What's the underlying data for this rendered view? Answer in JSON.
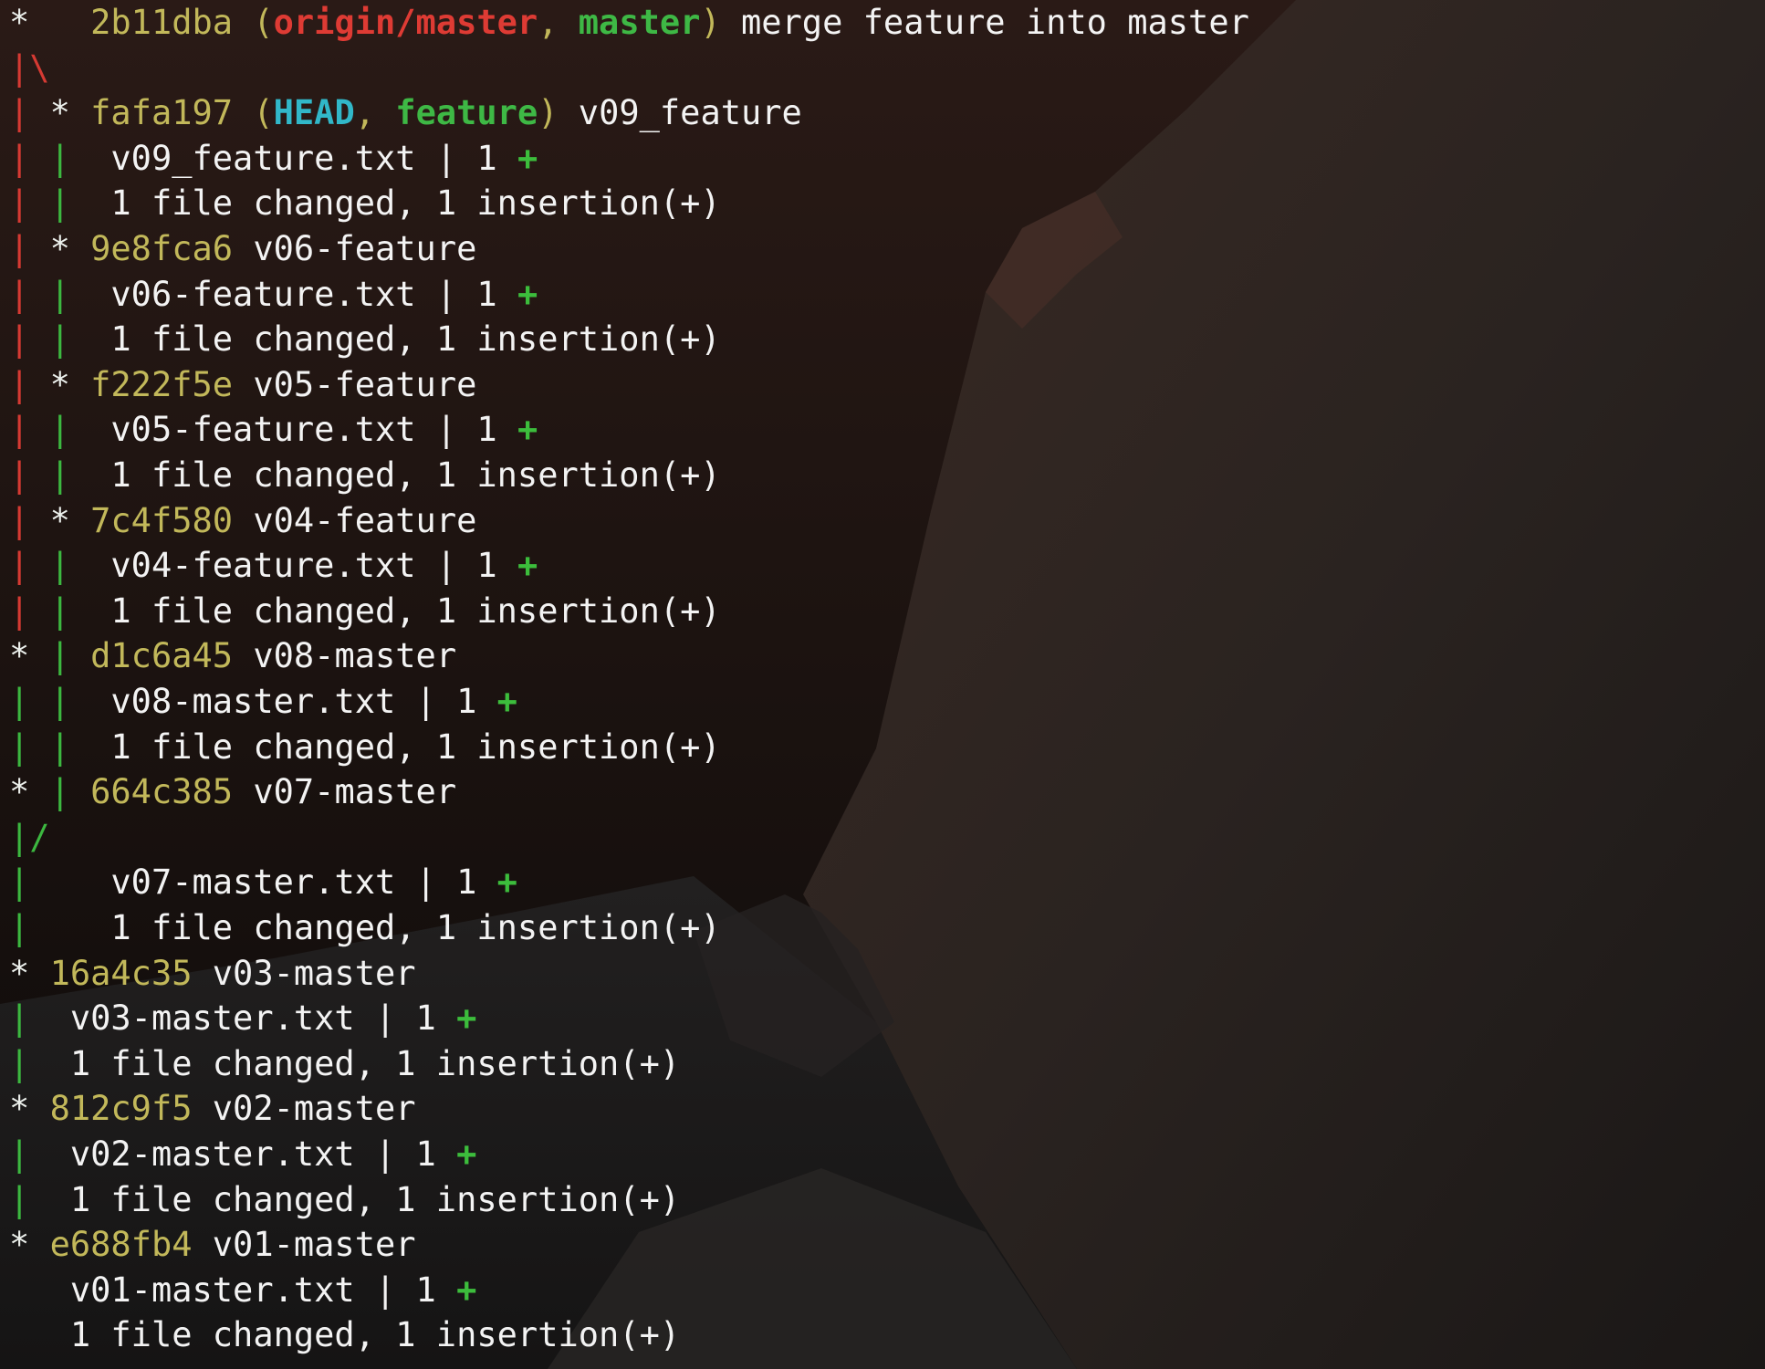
{
  "lines": [
    {
      "kind": "commit",
      "graph": [
        {
          "t": "*",
          "c": "white"
        },
        {
          "t": "   ",
          "c": "white"
        }
      ],
      "hash": "2b11dba",
      "refs": [
        {
          "t": "origin/master",
          "cls": "origin"
        },
        {
          "t": "master",
          "cls": "master-ref"
        }
      ],
      "message": "merge feature into master"
    },
    {
      "kind": "graph",
      "graph": [
        {
          "t": "|",
          "c": "red"
        },
        {
          "t": "\\",
          "c": "red"
        }
      ]
    },
    {
      "kind": "commit",
      "graph": [
        {
          "t": "| ",
          "c": "red"
        },
        {
          "t": "* ",
          "c": "white"
        }
      ],
      "hash": "fafa197",
      "refs": [
        {
          "t": "HEAD",
          "cls": "head"
        },
        {
          "t": "feature",
          "cls": "feature-ref"
        }
      ],
      "message": "v09_feature"
    },
    {
      "kind": "stat",
      "graph": [
        {
          "t": "| ",
          "c": "red"
        },
        {
          "t": "| ",
          "c": "green"
        }
      ],
      "file": "v09_feature.txt",
      "count": "1",
      "plus": "+"
    },
    {
      "kind": "summary",
      "graph": [
        {
          "t": "| ",
          "c": "red"
        },
        {
          "t": "| ",
          "c": "green"
        }
      ],
      "text": "1 file changed, 1 insertion(+)"
    },
    {
      "kind": "commit",
      "graph": [
        {
          "t": "| ",
          "c": "red"
        },
        {
          "t": "* ",
          "c": "white"
        }
      ],
      "hash": "9e8fca6",
      "refs": [],
      "message": "v06-feature"
    },
    {
      "kind": "stat",
      "graph": [
        {
          "t": "| ",
          "c": "red"
        },
        {
          "t": "| ",
          "c": "green"
        }
      ],
      "file": "v06-feature.txt",
      "count": "1",
      "plus": "+"
    },
    {
      "kind": "summary",
      "graph": [
        {
          "t": "| ",
          "c": "red"
        },
        {
          "t": "| ",
          "c": "green"
        }
      ],
      "text": "1 file changed, 1 insertion(+)"
    },
    {
      "kind": "commit",
      "graph": [
        {
          "t": "| ",
          "c": "red"
        },
        {
          "t": "* ",
          "c": "white"
        }
      ],
      "hash": "f222f5e",
      "refs": [],
      "message": "v05-feature"
    },
    {
      "kind": "stat",
      "graph": [
        {
          "t": "| ",
          "c": "red"
        },
        {
          "t": "| ",
          "c": "green"
        }
      ],
      "file": "v05-feature.txt",
      "count": "1",
      "plus": "+"
    },
    {
      "kind": "summary",
      "graph": [
        {
          "t": "| ",
          "c": "red"
        },
        {
          "t": "| ",
          "c": "green"
        }
      ],
      "text": "1 file changed, 1 insertion(+)"
    },
    {
      "kind": "commit",
      "graph": [
        {
          "t": "| ",
          "c": "red"
        },
        {
          "t": "* ",
          "c": "white"
        }
      ],
      "hash": "7c4f580",
      "refs": [],
      "message": "v04-feature"
    },
    {
      "kind": "stat",
      "graph": [
        {
          "t": "| ",
          "c": "red"
        },
        {
          "t": "| ",
          "c": "green"
        }
      ],
      "file": "v04-feature.txt",
      "count": "1",
      "plus": "+"
    },
    {
      "kind": "summary",
      "graph": [
        {
          "t": "| ",
          "c": "red"
        },
        {
          "t": "| ",
          "c": "green"
        }
      ],
      "text": "1 file changed, 1 insertion(+)"
    },
    {
      "kind": "commit",
      "graph": [
        {
          "t": "* ",
          "c": "white"
        },
        {
          "t": "| ",
          "c": "green"
        }
      ],
      "hash": "d1c6a45",
      "refs": [],
      "message": "v08-master"
    },
    {
      "kind": "stat",
      "graph": [
        {
          "t": "| ",
          "c": "green"
        },
        {
          "t": "| ",
          "c": "green"
        }
      ],
      "file": "v08-master.txt",
      "count": "1",
      "plus": "+"
    },
    {
      "kind": "summary",
      "graph": [
        {
          "t": "| ",
          "c": "green"
        },
        {
          "t": "| ",
          "c": "green"
        }
      ],
      "text": "1 file changed, 1 insertion(+)"
    },
    {
      "kind": "commit",
      "graph": [
        {
          "t": "* ",
          "c": "white"
        },
        {
          "t": "| ",
          "c": "green"
        }
      ],
      "hash": "664c385",
      "refs": [],
      "message": "v07-master"
    },
    {
      "kind": "graph",
      "graph": [
        {
          "t": "|",
          "c": "green"
        },
        {
          "t": "/",
          "c": "green"
        }
      ]
    },
    {
      "kind": "stat",
      "graph": [
        {
          "t": "| ",
          "c": "green"
        },
        {
          "t": "  ",
          "c": "green"
        }
      ],
      "file": "v07-master.txt",
      "count": "1",
      "plus": "+"
    },
    {
      "kind": "summary",
      "graph": [
        {
          "t": "| ",
          "c": "green"
        },
        {
          "t": "  ",
          "c": "green"
        }
      ],
      "text": "1 file changed, 1 insertion(+)"
    },
    {
      "kind": "commit",
      "graph": [
        {
          "t": "* ",
          "c": "white"
        }
      ],
      "hash": "16a4c35",
      "refs": [],
      "message": "v03-master"
    },
    {
      "kind": "stat",
      "graph": [
        {
          "t": "| ",
          "c": "green"
        }
      ],
      "file": "v03-master.txt",
      "count": "1",
      "plus": "+"
    },
    {
      "kind": "summary",
      "graph": [
        {
          "t": "| ",
          "c": "green"
        }
      ],
      "text": "1 file changed, 1 insertion(+)"
    },
    {
      "kind": "commit",
      "graph": [
        {
          "t": "* ",
          "c": "white"
        }
      ],
      "hash": "812c9f5",
      "refs": [],
      "message": "v02-master"
    },
    {
      "kind": "stat",
      "graph": [
        {
          "t": "| ",
          "c": "green"
        }
      ],
      "file": "v02-master.txt",
      "count": "1",
      "plus": "+"
    },
    {
      "kind": "summary",
      "graph": [
        {
          "t": "| ",
          "c": "green"
        }
      ],
      "text": "1 file changed, 1 insertion(+)"
    },
    {
      "kind": "commit",
      "graph": [
        {
          "t": "* ",
          "c": "white"
        }
      ],
      "hash": "e688fb4",
      "refs": [],
      "message": "v01-master"
    },
    {
      "kind": "stat",
      "graph": [
        {
          "t": "  ",
          "c": "white"
        }
      ],
      "file": "v01-master.txt",
      "count": "1",
      "plus": "+"
    },
    {
      "kind": "summary",
      "graph": [
        {
          "t": "  ",
          "c": "white"
        }
      ],
      "text": "1 file changed, 1 insertion(+)"
    }
  ],
  "colors": {
    "background": "#130f0d",
    "text": "#f3f3f3",
    "hash": "#c2b85a",
    "graph_red": "#d63a33",
    "graph_green": "#3cb840",
    "ref_origin": "#de3b34",
    "ref_master": "#3eb845",
    "ref_head": "#31b8c9",
    "ref_feature": "#3eb845",
    "plus": "#3cbd3c"
  }
}
